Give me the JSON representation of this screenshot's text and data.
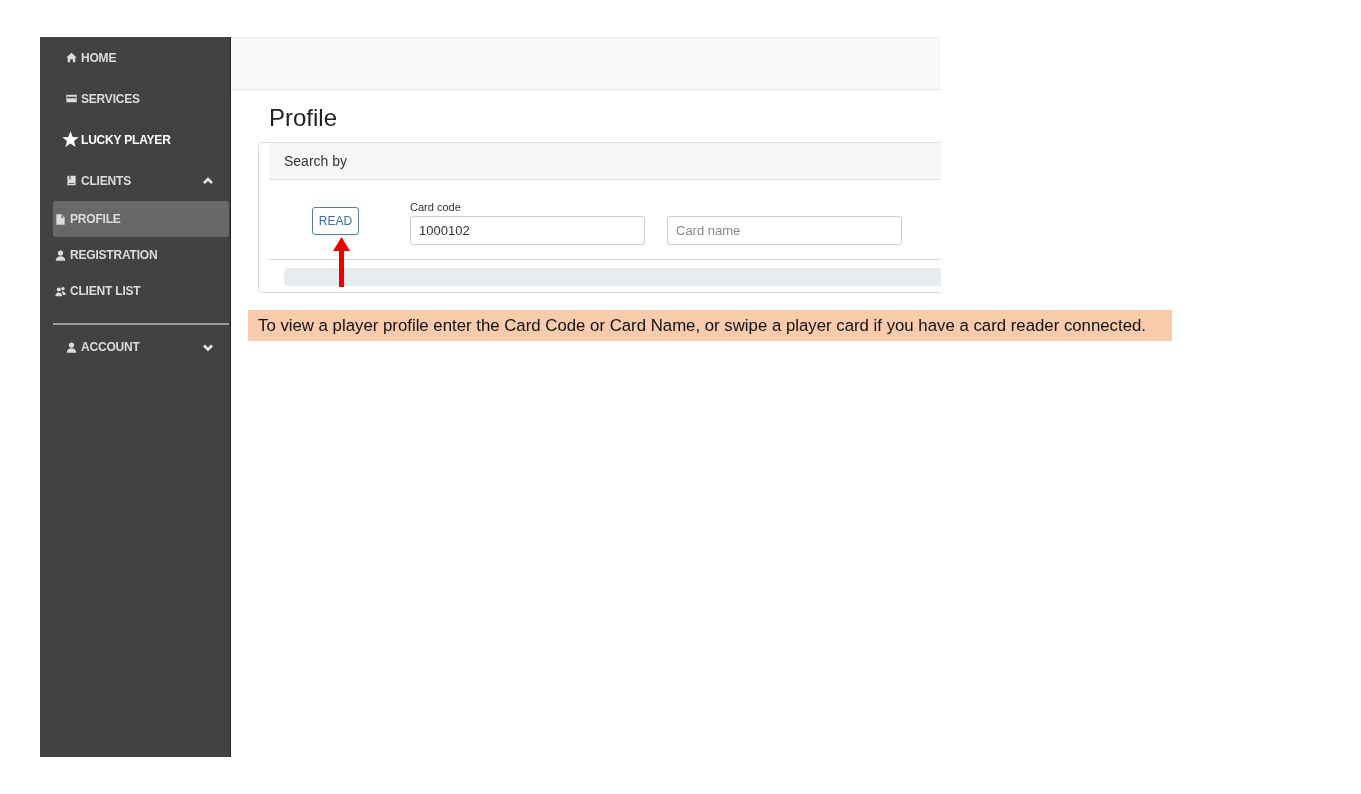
{
  "sidebar": {
    "items": [
      {
        "label": "HOME",
        "kind": "link",
        "selected": false
      },
      {
        "label": "SERVICES",
        "kind": "link",
        "selected": false
      },
      {
        "label": "LUCKY PLAYER",
        "kind": "feature",
        "selected": false
      },
      {
        "label": "CLIENTS",
        "kind": "group",
        "selected": false,
        "expanded": true,
        "children": [
          {
            "label": "PROFILE",
            "selected": true
          },
          {
            "label": "REGISTRATION",
            "selected": false
          },
          {
            "label": "CLIENT LIST",
            "selected": false
          }
        ]
      }
    ],
    "footer_items": [
      {
        "label": "ACCOUNT",
        "kind": "group",
        "selected": false,
        "expanded": false
      }
    ]
  },
  "page": {
    "title": "Profile"
  },
  "search_card": {
    "header": "Search by",
    "read_button": "READ",
    "fields": [
      {
        "label": "Card code",
        "value": "1000102"
      },
      {
        "placeholder": "Card name"
      }
    ]
  },
  "note": {
    "text": "To view a player profile enter the Card Code or Card Name, or swipe a player card if you have a card reader connected."
  }
}
